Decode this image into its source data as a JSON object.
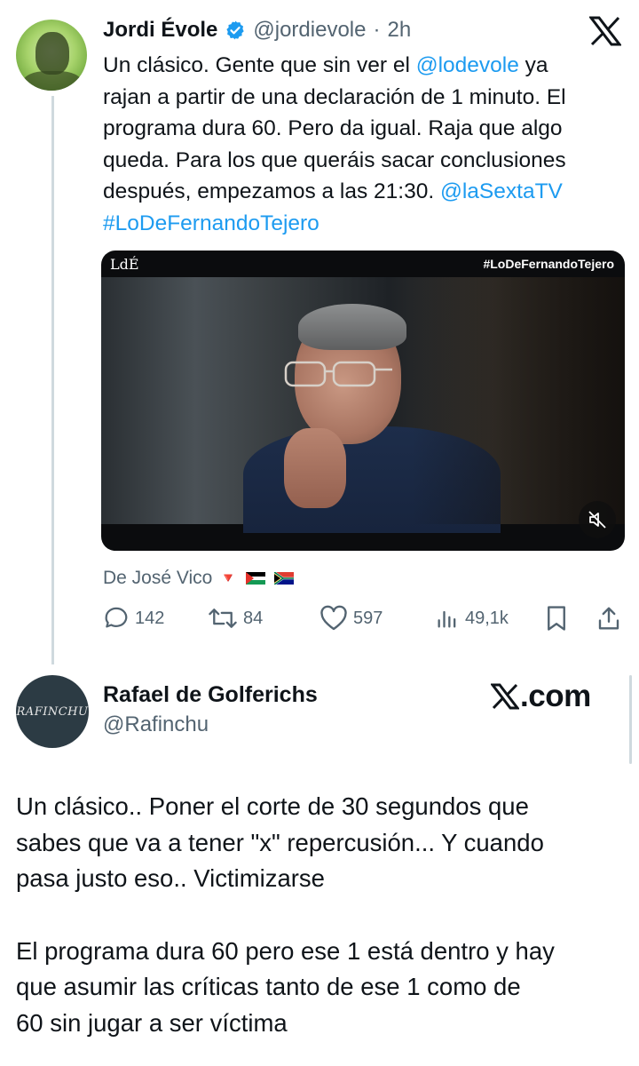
{
  "tweet1": {
    "author_name": "Jordi Évole",
    "handle": "@jordievole",
    "separator": "·",
    "time": "2h",
    "lines": [
      [
        "Un clásico. Gente que sin ver el ",
        "@lodevole",
        " ya"
      ],
      [
        "rajan a partir de una declaración de 1 minuto. El"
      ],
      [
        "programa dura 60. Pero da igual. Raja que algo"
      ],
      [
        "queda. Para los que queráis sacar conclusiones"
      ],
      [
        "después, empezamos a las 21:30. ",
        "@laSextaTV"
      ],
      [
        "#LoDeFernandoTejero"
      ]
    ],
    "video": {
      "logo": "LdÉ",
      "hashtag": "#LoDeFernandoTejero"
    },
    "from_label": "De José Vico",
    "from_emoji": "🔻",
    "stats": {
      "replies": "142",
      "retweets": "84",
      "likes": "597",
      "views": "49,1k"
    }
  },
  "tweet2": {
    "author_name": "Rafael de Golferichs",
    "handle": "@Rafinchu",
    "avatar_text": "RAFINCHU",
    "brand": ".com",
    "paragraphs": [
      [
        "Un clásico.. Poner el corte de 30 segundos que",
        "sabes que va a tener \"x\" repercusión... Y cuando",
        "pasa justo eso.. Victimizarse"
      ],
      [
        "El programa dura 60 pero ese 1 está dentro y hay",
        "que asumir las críticas tanto de ese 1 como de",
        "60 sin jugar a ser víctima"
      ]
    ]
  },
  "colors": {
    "link": "#1d9bf0",
    "secondary_text": "#536471",
    "primary_text": "#0f1419",
    "thread_line": "#cfd9de"
  },
  "icons": [
    "verified-badge-icon",
    "x-logo-icon",
    "mute-icon",
    "reply-icon",
    "retweet-icon",
    "like-icon",
    "views-icon",
    "bookmark-icon",
    "share-icon"
  ]
}
